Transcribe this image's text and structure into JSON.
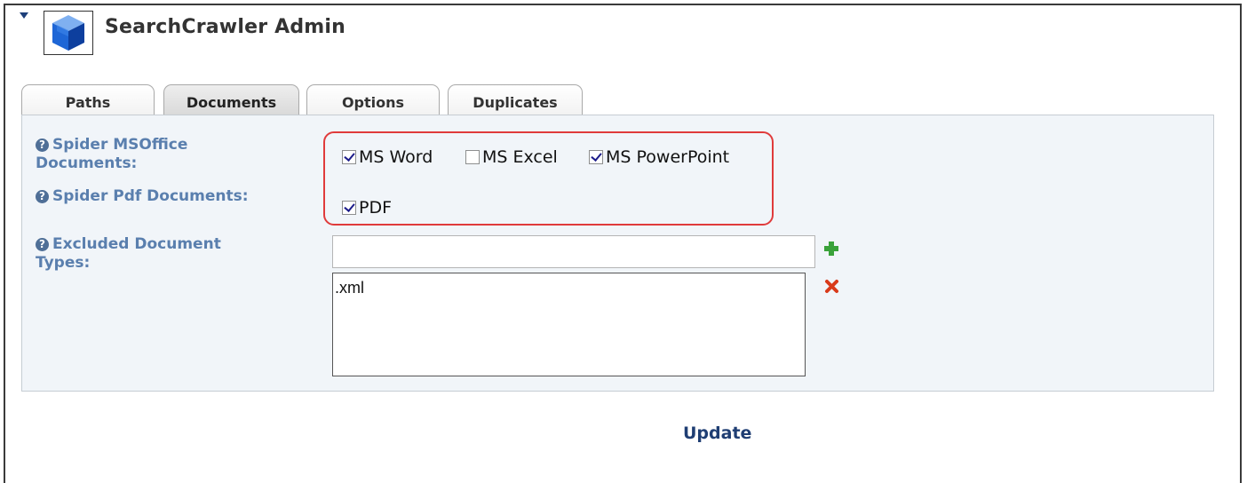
{
  "module": {
    "title": "SearchCrawler Admin",
    "icon": "cube-icon",
    "collapse_icon": "triangle-down-icon"
  },
  "tabs": [
    {
      "label": "Paths",
      "active": false
    },
    {
      "label": "Documents",
      "active": true
    },
    {
      "label": "Options",
      "active": false
    },
    {
      "label": "Duplicates",
      "active": false
    }
  ],
  "form": {
    "msoffice": {
      "label_line1": "Spider MSOffice",
      "label_line2": "Documents:",
      "options": [
        {
          "label": "MS Word",
          "checked": true
        },
        {
          "label": "MS Excel",
          "checked": false
        },
        {
          "label": "MS PowerPoint",
          "checked": true
        }
      ]
    },
    "pdf": {
      "label": "Spider Pdf Documents:",
      "options": [
        {
          "label": "PDF",
          "checked": true
        }
      ]
    },
    "excluded": {
      "label_line1": "Excluded Document",
      "label_line2": "Types:",
      "input_value": "",
      "list_items": [
        ".xml"
      ]
    }
  },
  "actions": {
    "update_label": "Update"
  },
  "colors": {
    "label": "#5a7fae",
    "highlight": "#e03b3b",
    "link": "#1f3e73",
    "add": "#3aa23a",
    "remove": "#d93a1a"
  }
}
